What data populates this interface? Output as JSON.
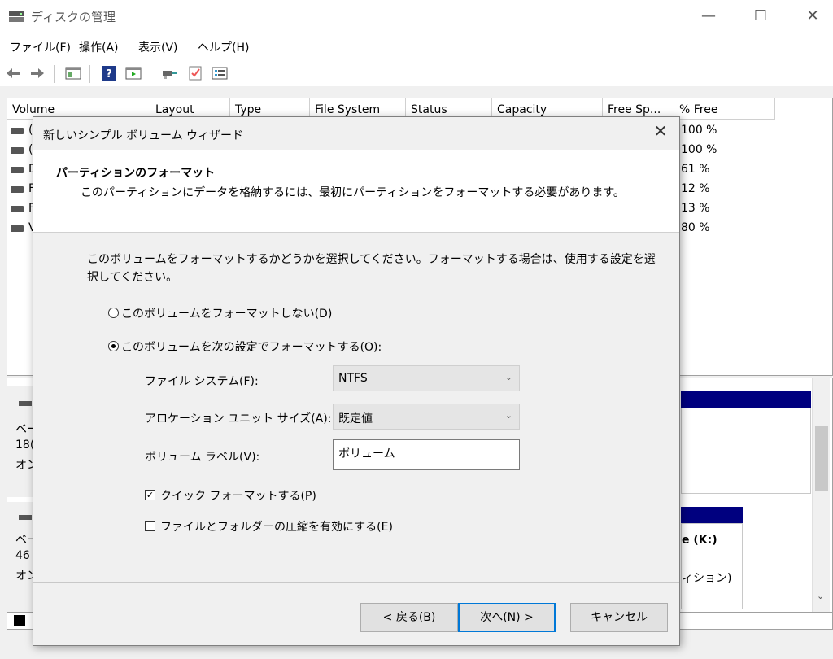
{
  "app": {
    "title": "ディスクの管理"
  },
  "window_controls": {
    "minimize": "—",
    "maximize": "☐",
    "close": "✕"
  },
  "menu": [
    "ファイル(F)",
    "操作(A)",
    "表示(V)",
    "ヘルプ(H)"
  ],
  "toolbar_icons": [
    "back-arrow-icon",
    "forward-arrow-icon",
    "console-tree-icon",
    "help-icon",
    "action-pane-icon",
    "connect-icon",
    "properties-icon",
    "list-icon"
  ],
  "volume_table": {
    "columns": [
      "Volume",
      "Layout",
      "Type",
      "File System",
      "Status",
      "Capacity",
      "Free Sp...",
      "% Free"
    ],
    "rows": [
      {
        "volume_fragment": "(",
        "pct_free": "100 %"
      },
      {
        "volume_fragment": "(",
        "pct_free": "100 %"
      },
      {
        "volume_fragment": "D",
        "pct_free": "61 %"
      },
      {
        "volume_fragment": "F",
        "pct_free": "12 %"
      },
      {
        "volume_fragment": "F",
        "pct_free": "13 %"
      },
      {
        "volume_fragment": "V",
        "pct_free": "80 %"
      }
    ]
  },
  "disk_panel": {
    "disk1": {
      "type_fragment": "ベー",
      "size_fragment": "18(",
      "status_fragment": "オン"
    },
    "disk2": {
      "type_fragment": "ベー",
      "size_fragment": "46",
      "status_fragment": "オン",
      "volume_label_fragment": "e  (K:)",
      "partition_fragment": "ィション)"
    }
  },
  "dialog": {
    "title": "新しいシンプル ボリューム ウィザード",
    "header_title": "パーティションのフォーマット",
    "header_subtitle": "このパーティションにデータを格納するには、最初にパーティションをフォーマットする必要があります。",
    "description": "このボリュームをフォーマットするかどうかを選択してください。フォーマットする場合は、使用する設定を選択してください。",
    "option_no_format": "このボリュームをフォーマットしない(D)",
    "option_format": "このボリュームを次の設定でフォーマットする(O):",
    "selected_option": "format",
    "fs_label": "ファイル システム(F):",
    "fs_value": "NTFS",
    "alloc_label": "アロケーション ユニット サイズ(A):",
    "alloc_value": "既定値",
    "vol_label_label": "ボリューム ラベル(V):",
    "vol_label_value": "ボリューム",
    "quick_format_label": "クイック フォーマットする(P)",
    "quick_format_checked": true,
    "compression_label": "ファイルとフォルダーの圧縮を有効にする(E)",
    "compression_checked": false,
    "back_button": "< 戻る(B)",
    "next_button": "次へ(N) >",
    "cancel_button": "キャンセル"
  },
  "colors": {
    "accent": "#0078d7",
    "disk_header": "#00007f"
  }
}
